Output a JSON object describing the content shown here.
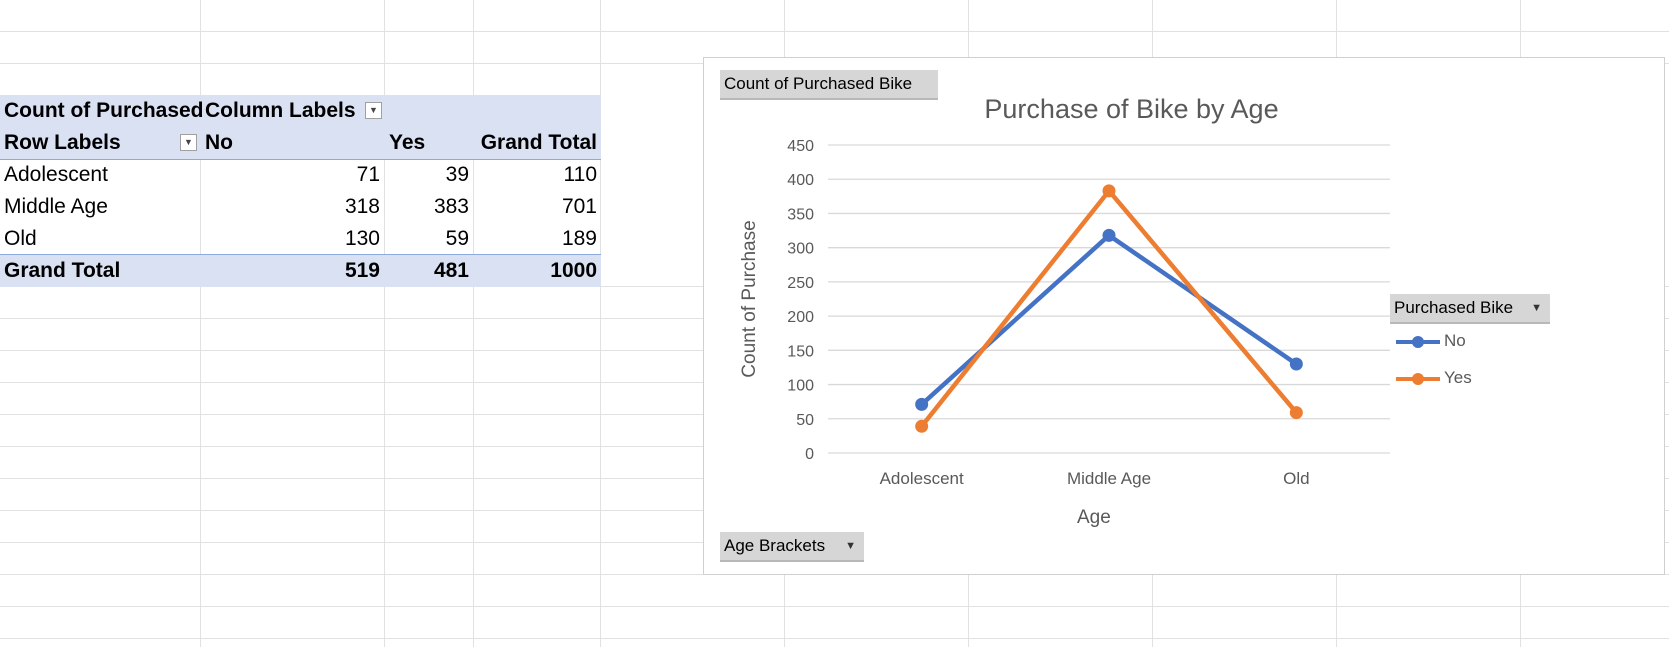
{
  "pivot": {
    "header1": {
      "col0": "Count of Purchased",
      "col1": "Column Labels"
    },
    "header2": {
      "col0": "Row Labels",
      "col1": "No",
      "col2": "Yes",
      "col3": "Grand Total"
    },
    "rows": [
      {
        "label": "Adolescent",
        "no": "71",
        "yes": "39",
        "total": "110"
      },
      {
        "label": "Middle Age",
        "no": "318",
        "yes": "383",
        "total": "701"
      },
      {
        "label": "Old",
        "no": "130",
        "yes": "59",
        "total": "189"
      }
    ],
    "grand_total": {
      "label": "Grand Total",
      "no": "519",
      "yes": "481",
      "total": "1000"
    }
  },
  "chart": {
    "value_field_button": "Count of Purchased Bike",
    "axis_field_button": "Age Brackets",
    "legend_field_button": "Purchased Bike"
  },
  "chart_data": {
    "type": "line",
    "title": "Purchase of Bike by Age",
    "xlabel": "Age",
    "ylabel": "Count of Purchase",
    "categories": [
      "Adolescent",
      "Middle Age",
      "Old"
    ],
    "series": [
      {
        "name": "No",
        "values": [
          71,
          318,
          130
        ],
        "color": "#4472c4"
      },
      {
        "name": "Yes",
        "values": [
          39,
          383,
          59
        ],
        "color": "#ed7d31"
      }
    ],
    "ylim": [
      0,
      450
    ],
    "yticks": [
      0,
      50,
      100,
      150,
      200,
      250,
      300,
      350,
      400,
      450
    ],
    "grid": true,
    "legend_position": "right"
  }
}
